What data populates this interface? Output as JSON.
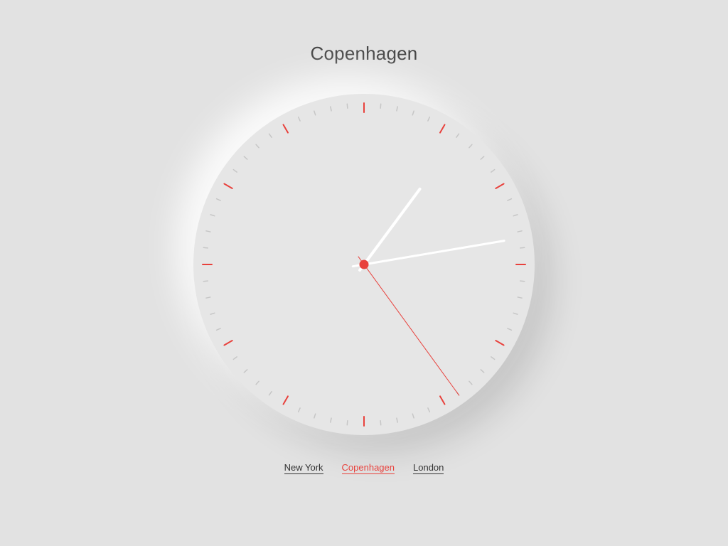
{
  "title": "Copenhagen",
  "colors": {
    "background": "#e2e2e2",
    "accent": "#e8413c",
    "text": "#444444",
    "minor_tick": "#c6c6c6",
    "hand": "#ffffff"
  },
  "clock": {
    "hour": 1,
    "minute": 13,
    "second": 24
  },
  "nav": [
    {
      "label": "New York",
      "active": false
    },
    {
      "label": "Copenhagen",
      "active": true
    },
    {
      "label": "London",
      "active": false
    }
  ]
}
